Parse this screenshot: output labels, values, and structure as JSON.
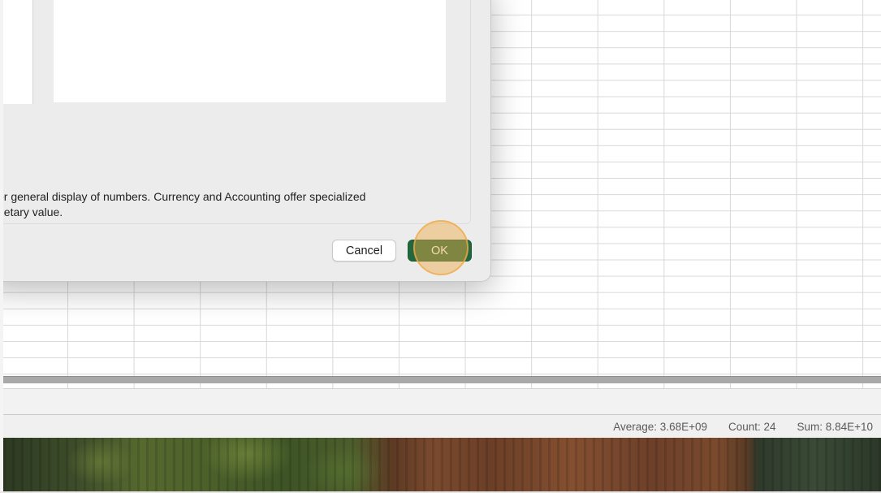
{
  "dialog": {
    "description_lines": [
      "or general display of numbers.  Currency and Accounting offer specialized",
      "netary value."
    ],
    "cancel_label": "Cancel",
    "ok_label": "OK"
  },
  "status_bar": {
    "average": "Average: 3.68E+09",
    "count": "Count: 24",
    "sum": "Sum: 8.84E+10"
  },
  "colors": {
    "accent_button": "#21683e",
    "click_highlight": "#f0aa46"
  }
}
